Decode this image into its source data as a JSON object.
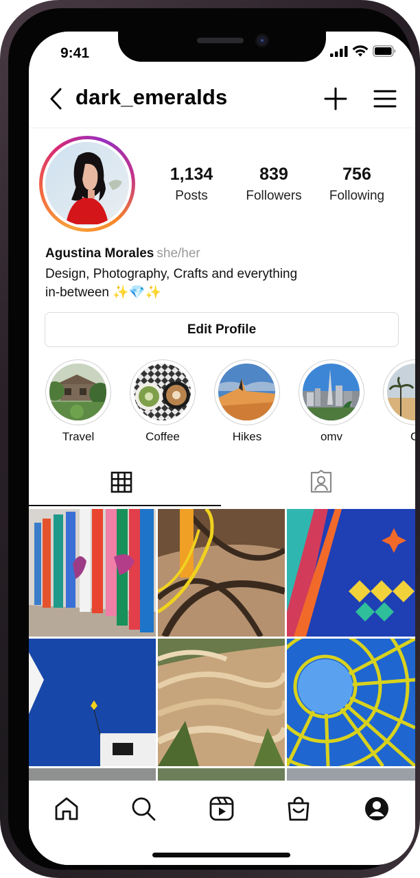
{
  "status_bar": {
    "time": "9:41"
  },
  "header": {
    "username": "dark_emeralds"
  },
  "profile": {
    "stats": [
      {
        "value": "1,134",
        "label": "Posts"
      },
      {
        "value": "839",
        "label": "Followers"
      },
      {
        "value": "756",
        "label": "Following"
      }
    ],
    "name": "Agustina Morales",
    "pronouns": "she/her",
    "bio_line1": "Design, Photography, Crafts and everything",
    "bio_line2": "in-between ✨💎✨",
    "edit_button": "Edit Profile"
  },
  "highlights": [
    {
      "label": "Travel"
    },
    {
      "label": "Coffee"
    },
    {
      "label": "Hikes"
    },
    {
      "label": "omv"
    },
    {
      "label": "Ci"
    }
  ],
  "tabs": [
    {
      "icon": "grid-icon",
      "selected": true
    },
    {
      "icon": "tagged-icon",
      "selected": false
    }
  ],
  "bottom_nav": [
    {
      "icon": "home-icon"
    },
    {
      "icon": "search-icon"
    },
    {
      "icon": "reels-icon"
    },
    {
      "icon": "shop-icon"
    },
    {
      "icon": "profile-icon"
    }
  ],
  "colors": {
    "story_ring_start": "#f9a13a",
    "story_ring_end": "#962fbf",
    "text": "#111111",
    "muted": "#9a9a9a",
    "divider": "#dbdbdb"
  }
}
